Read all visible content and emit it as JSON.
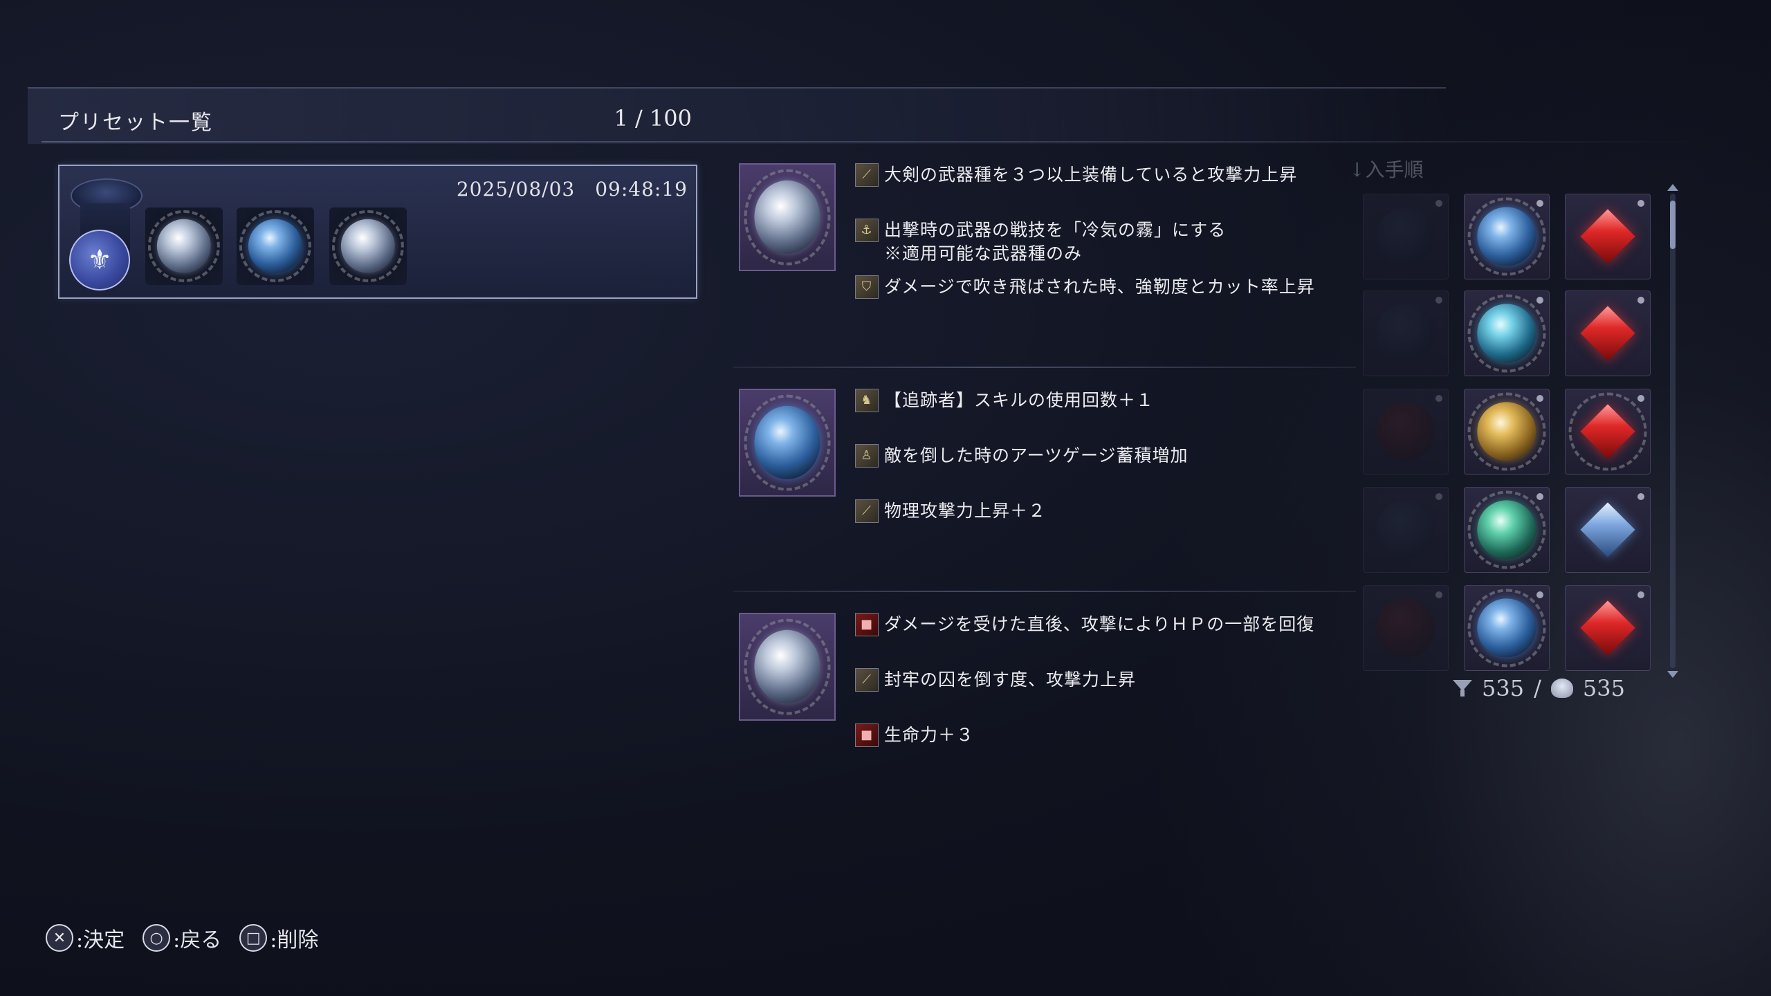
{
  "header": {
    "title": "プリセット一覧",
    "count": "1 / 100"
  },
  "preset": {
    "timestamp": "2025/08/03　09:48:19"
  },
  "sort": {
    "label": "↓入手順"
  },
  "relics": [
    {
      "orb": "white",
      "effects": [
        {
          "icon": "sword-icon",
          "text": "大剣の武器種を３つ以上装備していると攻撃力上昇",
          "note": ""
        },
        {
          "icon": "skill-icon",
          "text": "出撃時の武器の戦技を「冷気の霧」にする",
          "note": "※適用可能な武器種のみ"
        },
        {
          "icon": "shield-icon",
          "text": "ダメージで吹き飛ばされた時、強靭度とカット率上昇",
          "note": ""
        }
      ]
    },
    {
      "orb": "blue",
      "effects": [
        {
          "icon": "character-icon",
          "text": "【追跡者】スキルの使用回数＋１",
          "note": ""
        },
        {
          "icon": "arts-icon",
          "text": "敵を倒した時のアーツゲージ蓄積増加",
          "note": ""
        },
        {
          "icon": "sword-icon",
          "text": "物理攻撃力上昇＋２",
          "note": ""
        }
      ]
    },
    {
      "orb": "white",
      "effects": [
        {
          "icon": "heal-icon",
          "text": "ダメージを受けた直後、攻撃によりＨＰの一部を回復",
          "note": ""
        },
        {
          "icon": "sword-icon",
          "text": "封牢の囚を倒す度、攻撃力上昇",
          "note": ""
        },
        {
          "icon": "vigor-icon",
          "text": "生命力＋３",
          "note": ""
        }
      ]
    }
  ],
  "capacity": {
    "current": "535",
    "separator": "/",
    "max": "535"
  },
  "footer": {
    "confirm_glyph": "✕",
    "confirm_label": ":決定",
    "back_glyph": "○",
    "back_label": ":戻る",
    "delete_glyph": "□",
    "delete_label": ":削除"
  }
}
